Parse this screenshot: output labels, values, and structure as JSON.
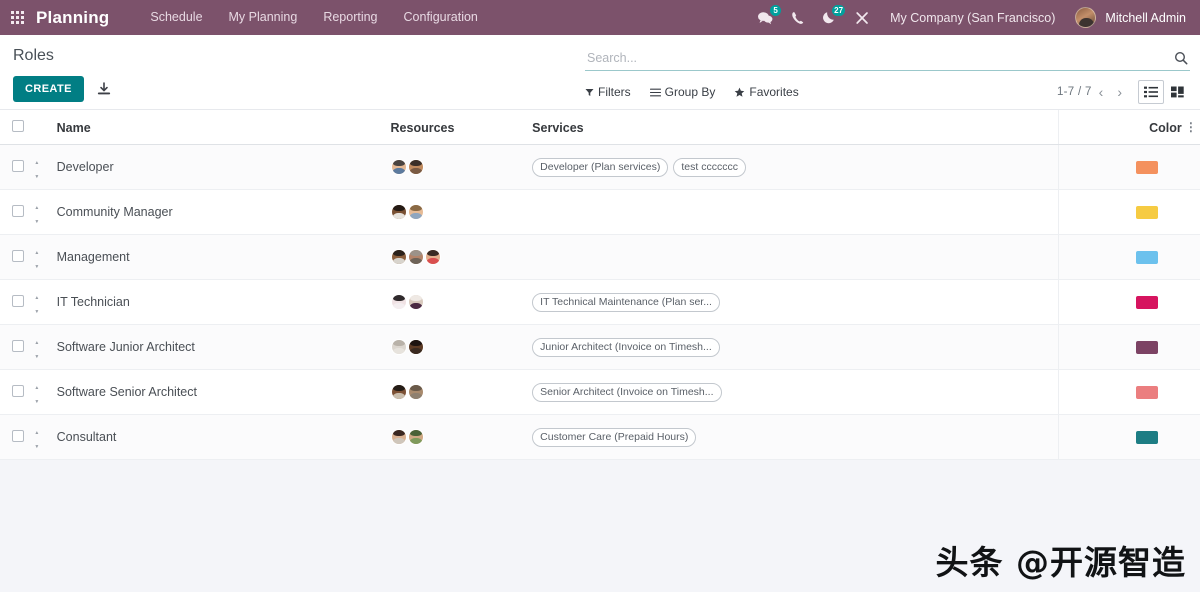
{
  "navbar": {
    "apps_icon": "apps-grid-icon",
    "brand": "Planning",
    "menu": [
      {
        "label": "Schedule"
      },
      {
        "label": "My Planning"
      },
      {
        "label": "Reporting"
      },
      {
        "label": "Configuration"
      }
    ],
    "messages_icon": "messages-icon",
    "messages_count": "5",
    "voip_icon": "phone-icon",
    "activities_icon": "clock-icon",
    "activities_count": "27",
    "debug_icon": "bug-close-icon",
    "company": "My Company (San Francisco)",
    "user": "Mitchell Admin",
    "accent": "#7C526B",
    "badge_color": "#00A09D"
  },
  "control_panel": {
    "breadcrumb": "Roles",
    "create_label": "CREATE",
    "upload_icon": "upload-import-icon",
    "search": {
      "placeholder": "Search...",
      "value": "",
      "icon": "search-icon"
    },
    "filters_label": "Filters",
    "filters_icon": "funnel-icon",
    "group_by_label": "Group By",
    "group_by_icon": "list-lines-icon",
    "favorites_label": "Favorites",
    "favorites_icon": "star-icon",
    "pager": "1-7 / 7",
    "prev_icon": "chevron-left-icon",
    "next_icon": "chevron-right-icon",
    "view_list_icon": "list-view-icon",
    "view_kanban_icon": "kanban-view-icon",
    "active_view": "list",
    "create_button_color": "#017E84"
  },
  "table": {
    "columns": [
      "",
      "",
      "Name",
      "Resources",
      "Services",
      "Color",
      ""
    ],
    "headers": {
      "name": "Name",
      "resources": "Resources",
      "services": "Services",
      "color": "Color"
    },
    "optional_columns_icon": "vertical-dots-icon",
    "rows": [
      {
        "name": "Developer",
        "resources": [
          {
            "name": "avatar",
            "skin": "#e4b894",
            "hair": "#4a4340",
            "shirt": "#5c7a9e"
          },
          {
            "name": "avatar",
            "skin": "#c08a5e",
            "hair": "#3b2f28",
            "shirt": "#7a5a43"
          }
        ],
        "services": [
          "Developer (Plan services)",
          "test ccccccc"
        ],
        "color": "#F4915E"
      },
      {
        "name": "Community Manager",
        "resources": [
          {
            "name": "avatar",
            "skin": "#7a5134",
            "hair": "#241a14",
            "shirt": "#e8e4de"
          },
          {
            "name": "avatar",
            "skin": "#e6bb96",
            "hair": "#8a6a45",
            "shirt": "#8fa6bf"
          }
        ],
        "services": [],
        "color": "#F6CB42"
      },
      {
        "name": "Management",
        "resources": [
          {
            "name": "avatar",
            "skin": "#8b5e3c",
            "hair": "#2b211a",
            "shirt": "#d8d4cd"
          },
          {
            "name": "avatar",
            "skin": "#b4846a",
            "hair": "#9c9289",
            "shirt": "#6e6358"
          },
          {
            "name": "avatar",
            "skin": "#e3ae8c",
            "hair": "#3a2a22",
            "shirt": "#d94f4f"
          }
        ],
        "services": [],
        "color": "#6CC1ED"
      },
      {
        "name": "IT Technician",
        "resources": [
          {
            "name": "avatar",
            "skin": "#f0e2e4",
            "hair": "#2f2a2c",
            "shirt": "#f4eef0"
          },
          {
            "name": "avatar",
            "skin": "#d8c9bd",
            "hair": "#efe9e4",
            "shirt": "#4b2a43"
          }
        ],
        "services": [
          "IT Technical Maintenance (Plan ser..."
        ],
        "color": "#D6145F"
      },
      {
        "name": "Software Junior Architect",
        "resources": [
          {
            "name": "avatar",
            "skin": "#dcd6cf",
            "hair": "#b9b2a9",
            "shirt": "#e7e3dd"
          },
          {
            "name": "avatar",
            "skin": "#5c3a24",
            "hair": "#1d1310",
            "shirt": "#3a2a20"
          }
        ],
        "services": [
          "Junior Architect (Invoice on Timesh..."
        ],
        "color": "#7C4364"
      },
      {
        "name": "Software Senior Architect",
        "resources": [
          {
            "name": "avatar",
            "skin": "#7d5135",
            "hair": "#241c16",
            "shirt": "#cbbfae"
          },
          {
            "name": "avatar",
            "skin": "#a98a6d",
            "hair": "#6a5a4a",
            "shirt": "#8e8070"
          }
        ],
        "services": [
          "Senior Architect (Invoice on Timesh..."
        ],
        "color": "#EB7E7F"
      },
      {
        "name": "Consultant",
        "resources": [
          {
            "name": "avatar",
            "skin": "#d9b091",
            "hair": "#3a2620",
            "shirt": "#cfc6bb"
          },
          {
            "name": "avatar",
            "skin": "#cfa884",
            "hair": "#4a6137",
            "shirt": "#7f9a5c"
          }
        ],
        "services": [
          "Customer Care (Prepaid Hours)"
        ],
        "color": "#1D7D84"
      }
    ]
  },
  "watermark": "头条 @开源智造"
}
